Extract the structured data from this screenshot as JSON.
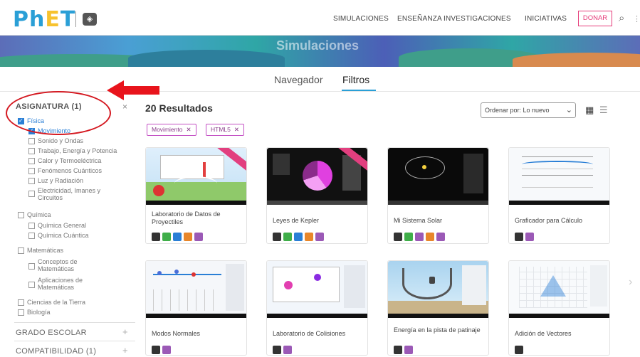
{
  "header": {
    "logo_text": "PhET",
    "nav": [
      "SIMULACIONES",
      "ENSEÑANZA",
      "INVESTIGACIONES",
      "INICIATIVAS"
    ],
    "donate": "DONAR"
  },
  "banner": {
    "title": "Simulaciones"
  },
  "tabs": [
    "Navegador",
    "Filtros"
  ],
  "sidebar": {
    "subject_heading": "ASIGNATURA (1)",
    "subjects": [
      {
        "label": "Física",
        "checked": true,
        "level": 0
      },
      {
        "label": "Movimiento",
        "checked": true,
        "level": 1
      },
      {
        "label": "Sonido y Ondas",
        "checked": false,
        "level": 1
      },
      {
        "label": "Trabajo, Energía y Potencia",
        "checked": false,
        "level": 1
      },
      {
        "label": "Calor y Termoeléctrica",
        "checked": false,
        "level": 1
      },
      {
        "label": "Fenómenos Cuánticos",
        "checked": false,
        "level": 1
      },
      {
        "label": "Luz y Radiación",
        "checked": false,
        "level": 1
      },
      {
        "label": "Electricidad, Imanes y",
        "label2": "Circuitos",
        "checked": false,
        "level": 1
      },
      {
        "label": "Química",
        "checked": false,
        "level": 0
      },
      {
        "label": "Química General",
        "checked": false,
        "level": 1
      },
      {
        "label": "Química Cuántica",
        "checked": false,
        "level": 1
      },
      {
        "label": "Matemáticas",
        "checked": false,
        "level": 0
      },
      {
        "label": "Conceptos de",
        "label2": "Matemáticas",
        "checked": false,
        "level": 1
      },
      {
        "label": "Aplicaciones de",
        "label2": "Matemáticas",
        "checked": false,
        "level": 1
      },
      {
        "label": "Ciencias de la Tierra",
        "checked": false,
        "level": 0
      },
      {
        "label": "Biología",
        "checked": false,
        "level": 0
      }
    ],
    "grade_heading": "GRADO ESCOLAR",
    "compat_heading": "COMPATIBILIDAD (1)"
  },
  "results": {
    "title": "20 Resultados",
    "chips": [
      "Movimiento",
      "HTML5"
    ],
    "sort_label": "Ordenar por: Lo nuevo"
  },
  "cards": [
    {
      "title": "Laboratorio de Datos de Proyectiles",
      "badges": [
        "#333333",
        "#3fae49",
        "#2a7fd6",
        "#e8862a",
        "#9b59b6"
      ],
      "new": true
    },
    {
      "title": "Leyes de Kepler",
      "badges": [
        "#333333",
        "#3fae49",
        "#2a7fd6",
        "#e8862a",
        "#9b59b6"
      ],
      "new": true
    },
    {
      "title": "Mi Sistema Solar",
      "badges": [
        "#333333",
        "#3fae49",
        "#9b59b6",
        "#e8862a",
        "#9b59b6"
      ],
      "new": false
    },
    {
      "title": "Graficador para Cálculo",
      "badges": [
        "#333333",
        "#9b59b6"
      ],
      "new": false
    },
    {
      "title": "Modos Normales",
      "badges": [
        "#333333",
        "#9b59b6"
      ],
      "new": false
    },
    {
      "title": "Laboratorio de Colisiones",
      "badges": [
        "#333333",
        "#9b59b6"
      ],
      "new": false
    },
    {
      "title": "Energía en la pista de patinaje",
      "badges": [
        "#333333",
        "#9b59b6"
      ],
      "new": false
    },
    {
      "title": "Adición de Vectores",
      "badges": [
        "#333333",
        "#9b59b6"
      ],
      "new": false
    }
  ],
  "colors": {
    "accent": "#2a9fd6",
    "chip": "#c34fc4",
    "annotation": "#e8141c"
  }
}
